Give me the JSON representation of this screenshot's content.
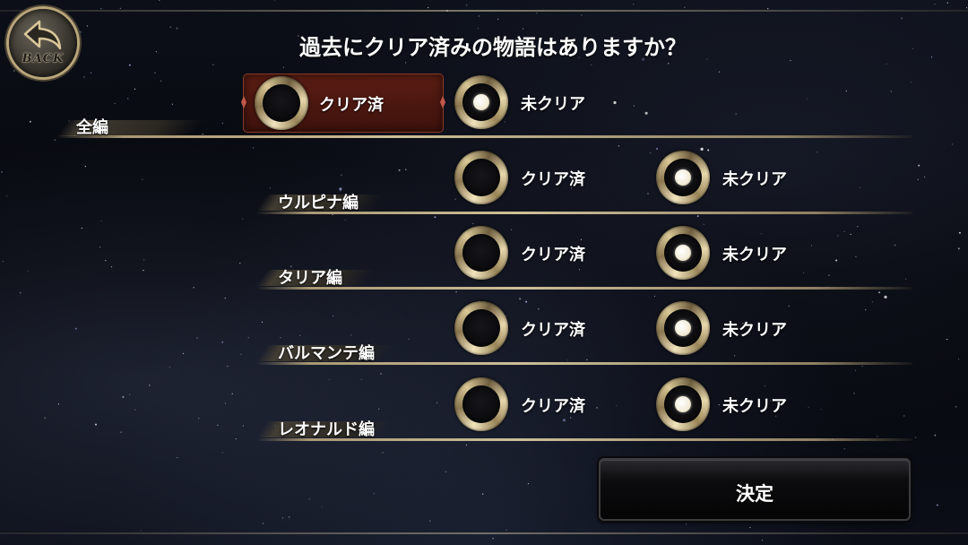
{
  "header": {
    "back_label": "BACK",
    "title": "過去にクリア済みの物語はありますか？"
  },
  "rows": [
    {
      "label": "全編",
      "options": [
        {
          "label": "クリア済",
          "selected": false,
          "highlighted": true
        },
        {
          "label": "未クリア",
          "selected": true,
          "highlighted": false
        }
      ]
    },
    {
      "label": "ウルピナ編",
      "options": [
        {
          "label": "クリア済",
          "selected": false
        },
        {
          "label": "未クリア",
          "selected": true
        }
      ]
    },
    {
      "label": "タリア編",
      "options": [
        {
          "label": "クリア済",
          "selected": false
        },
        {
          "label": "未クリア",
          "selected": true
        }
      ]
    },
    {
      "label": "バルマンテ編",
      "options": [
        {
          "label": "クリア済",
          "selected": false
        },
        {
          "label": "未クリア",
          "selected": true
        }
      ]
    },
    {
      "label": "レオナルド編",
      "options": [
        {
          "label": "クリア済",
          "selected": false
        },
        {
          "label": "未クリア",
          "selected": true
        }
      ]
    }
  ],
  "footer": {
    "confirm_label": "決定"
  },
  "colors": {
    "gold_ring": "#d9c796",
    "highlight_red": "#5a1d14",
    "background": "#06070c"
  },
  "icons": {
    "back": "back-arrow-icon",
    "radio": "radio-ring-icon"
  }
}
